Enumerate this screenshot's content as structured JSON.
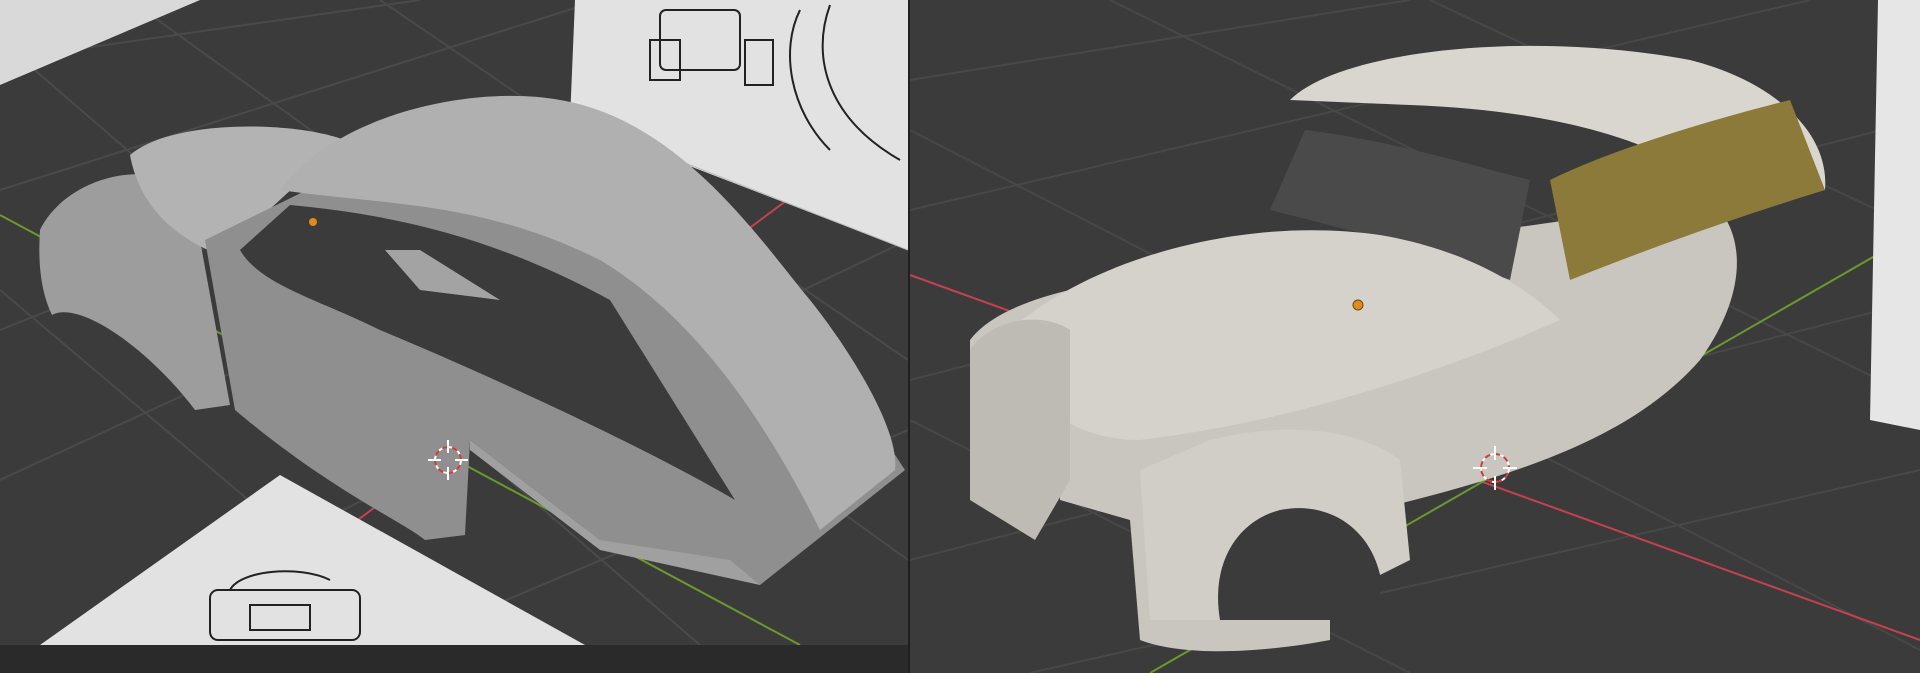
{
  "app": {
    "name": "",
    "layout": "dual-3d-viewport"
  },
  "viewports": [
    {
      "id": "left",
      "shading": "solid",
      "subject": "car-body-mesh",
      "reference_images": 2
    },
    {
      "id": "right",
      "shading": "rendered",
      "subject": "car-body-mesh",
      "reference_images": 1
    }
  ],
  "colors": {
    "viewport_background": "#3b3b3b",
    "grid_line": "#4a4a4a",
    "x_axis": "#c6414f",
    "y_axis": "#6a9a2c",
    "origin_marker": "#e08a1f",
    "solid_mesh": "#a8a8a8",
    "rendered_mesh": "#cfcdc6",
    "glass_tint": "#8c7a3a"
  },
  "icons": [
    "origin-dot-icon",
    "3d-cursor-icon"
  ]
}
